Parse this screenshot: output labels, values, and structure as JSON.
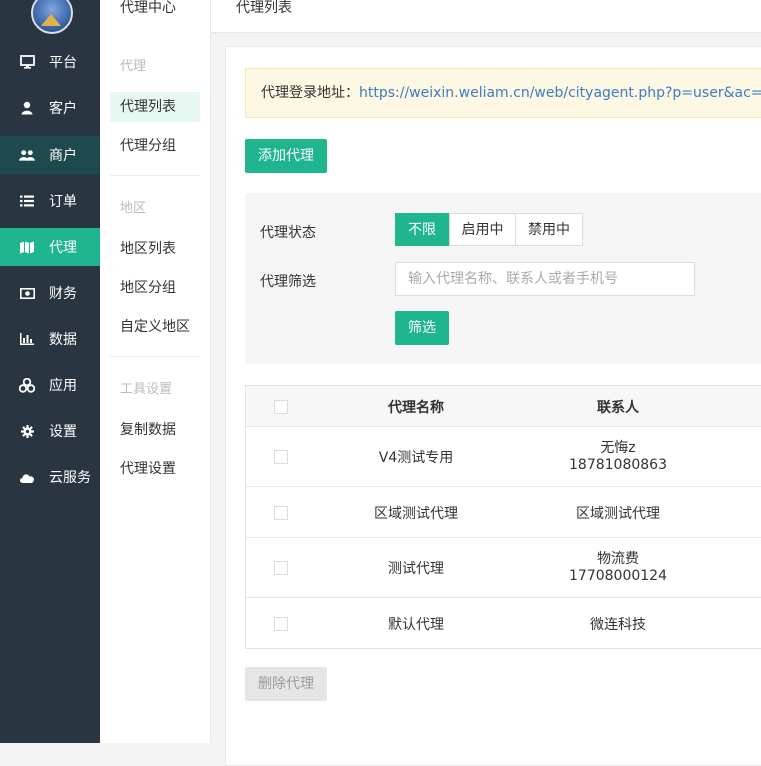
{
  "nav": {
    "items": [
      {
        "label": "平台",
        "icon": "monitor-icon"
      },
      {
        "label": "客户",
        "icon": "user-icon"
      },
      {
        "label": "商户",
        "icon": "users-icon"
      },
      {
        "label": "订单",
        "icon": "list-icon"
      },
      {
        "label": "代理",
        "icon": "map-icon"
      },
      {
        "label": "财务",
        "icon": "money-icon"
      },
      {
        "label": "数据",
        "icon": "bar-chart-icon"
      },
      {
        "label": "应用",
        "icon": "apps-icon"
      },
      {
        "label": "设置",
        "icon": "gear-icon"
      },
      {
        "label": "云服务",
        "icon": "cloud-icon"
      }
    ]
  },
  "subnav": {
    "title": "代理中心",
    "groups": [
      {
        "label": "代理",
        "links": [
          "代理列表",
          "代理分组"
        ]
      },
      {
        "label": "地区",
        "links": [
          "地区列表",
          "地区分组",
          "自定义地区"
        ]
      },
      {
        "label": "工具设置",
        "links": [
          "复制数据",
          "代理设置"
        ]
      }
    ]
  },
  "topbar": {
    "breadcrumb": "代理列表"
  },
  "notice": {
    "label": "代理登录地址：",
    "url": "https://weixin.weliam.cn/web/cityagent.php?p=user&ac=login&do"
  },
  "actions": {
    "add": "添加代理",
    "delete": "删除代理"
  },
  "filter": {
    "status_label": "代理状态",
    "status_options": [
      "不限",
      "启用中",
      "禁用中"
    ],
    "search_label": "代理筛选",
    "search_placeholder": "输入代理名称、联系人或者手机号",
    "search_value": "",
    "submit": "筛选"
  },
  "table": {
    "headers": [
      "代理名称",
      "联系人"
    ],
    "rows": [
      {
        "name": "V4测试专用",
        "contact": "无悔z",
        "phone": "18781080863"
      },
      {
        "name": "区域测试代理",
        "contact": "区域测试代理",
        "phone": ""
      },
      {
        "name": "测试代理",
        "contact": "物流费",
        "phone": "17708000124"
      },
      {
        "name": "默认代理",
        "contact": "微连科技",
        "phone": ""
      }
    ]
  },
  "colors": {
    "accent": "#1fb58f",
    "sidebar": "#2a3542",
    "notice_bg": "#fcf8e3",
    "link": "#3f7cc1"
  }
}
